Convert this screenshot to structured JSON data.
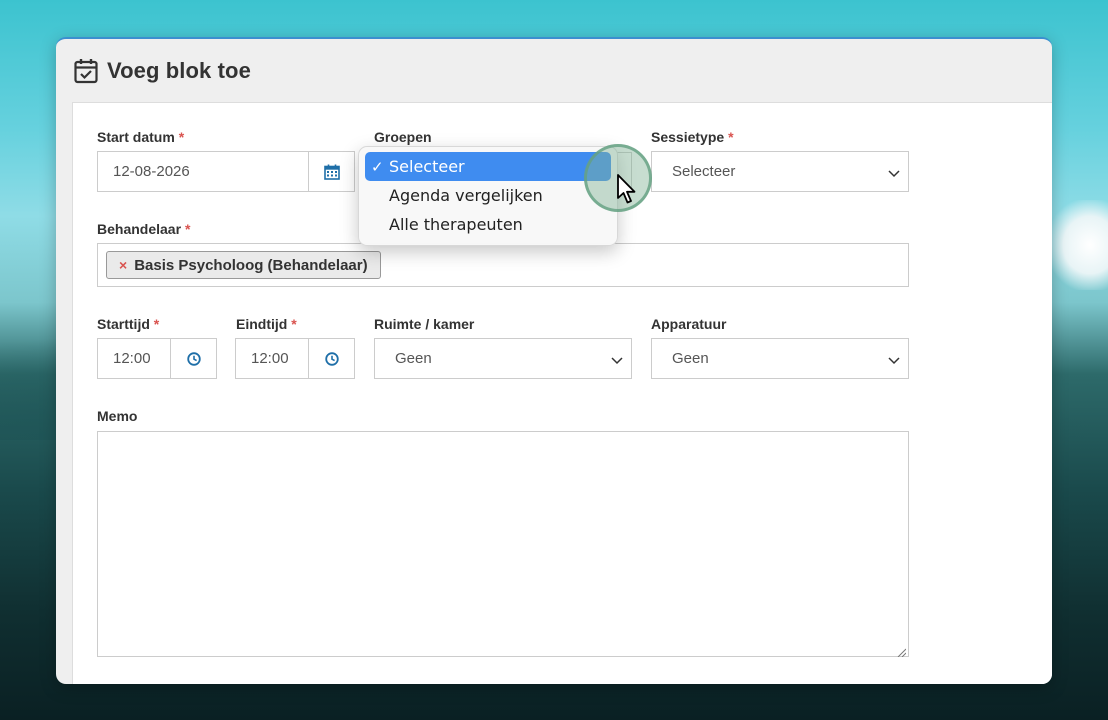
{
  "modal": {
    "title": "Voeg blok toe",
    "icon": "calendar-check-icon"
  },
  "form": {
    "start_date": {
      "label": "Start datum",
      "required": "*",
      "value": "12-08-2026",
      "icon": "calendar-icon"
    },
    "groups": {
      "label": "Groepen",
      "value": "Selecteer"
    },
    "session_type": {
      "label": "Sessietype",
      "required": "*",
      "value": "Selecteer"
    },
    "practitioner": {
      "label": "Behandelaar",
      "required": "*",
      "tag": "Basis Psycholoog (Behandelaar)",
      "tag_remove": "×"
    },
    "start_time": {
      "label": "Starttijd",
      "required": "*",
      "value": "12:00",
      "icon": "clock-icon"
    },
    "end_time": {
      "label": "Eindtijd",
      "required": "*",
      "value": "12:00",
      "icon": "clock-icon"
    },
    "room": {
      "label": "Ruimte / kamer",
      "value": "Geen"
    },
    "equipment": {
      "label": "Apparatuur",
      "value": "Geen"
    },
    "memo": {
      "label": "Memo",
      "value": ""
    }
  },
  "groups_dropdown": {
    "options": [
      {
        "label": "Selecteer",
        "selected": true,
        "check": "✓"
      },
      {
        "label": "Agenda vergelijken",
        "selected": false
      },
      {
        "label": "Alle therapeuten",
        "selected": false
      }
    ]
  },
  "colors": {
    "accent_blue": "#1f6fa8",
    "required_red": "#d9534f",
    "dropdown_highlight": "#3f8cf0"
  }
}
